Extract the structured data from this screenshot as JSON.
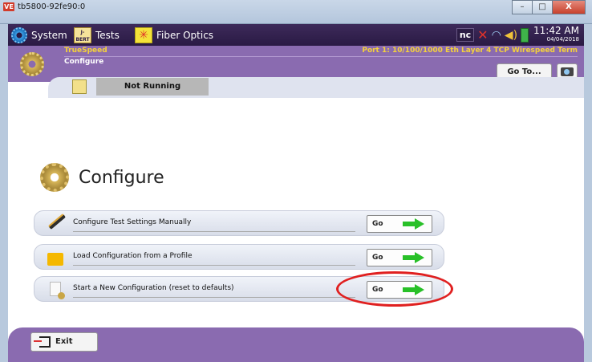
{
  "window": {
    "title": "tb5800-92fe90:0",
    "app_icon_text": "VE",
    "controls": [
      "minimize",
      "maximize",
      "close"
    ],
    "close_label": "X"
  },
  "topbar": {
    "tabs": [
      {
        "label": "System",
        "icon": "gear-icon"
      },
      {
        "label": "Tests",
        "icon": "bert-icon",
        "icon_text": "J-BERT"
      },
      {
        "label": "Fiber Optics",
        "icon": "fiber-icon"
      }
    ],
    "tray": {
      "nc_label": "nc",
      "time": "11:42 AM",
      "date": "04/04/2018"
    }
  },
  "header": {
    "app_name": "TrueSpeed",
    "section": "Configure",
    "port_info": "Port 1: 10/100/1000 Eth Layer 4 TCP Wirespeed Term",
    "goto_label": "Go To..."
  },
  "status": {
    "text": "Not Running"
  },
  "main": {
    "title": "Configure",
    "options": [
      {
        "label": "Configure Test Settings Manually",
        "button": "Go",
        "icon": "pencil-icon"
      },
      {
        "label": "Load Configuration from a Profile",
        "button": "Go",
        "icon": "folder-icon"
      },
      {
        "label": "Start a New Configuration (reset to defaults)",
        "button": "Go",
        "icon": "document-gear-icon"
      }
    ]
  },
  "footer": {
    "exit_label": "Exit"
  },
  "colors": {
    "header_purple": "#8a6bb0",
    "topbar_dark": "#2a1a44",
    "accent_yellow": "#f5d23a",
    "go_arrow_green": "#28c028",
    "highlight_red": "#e02020"
  }
}
